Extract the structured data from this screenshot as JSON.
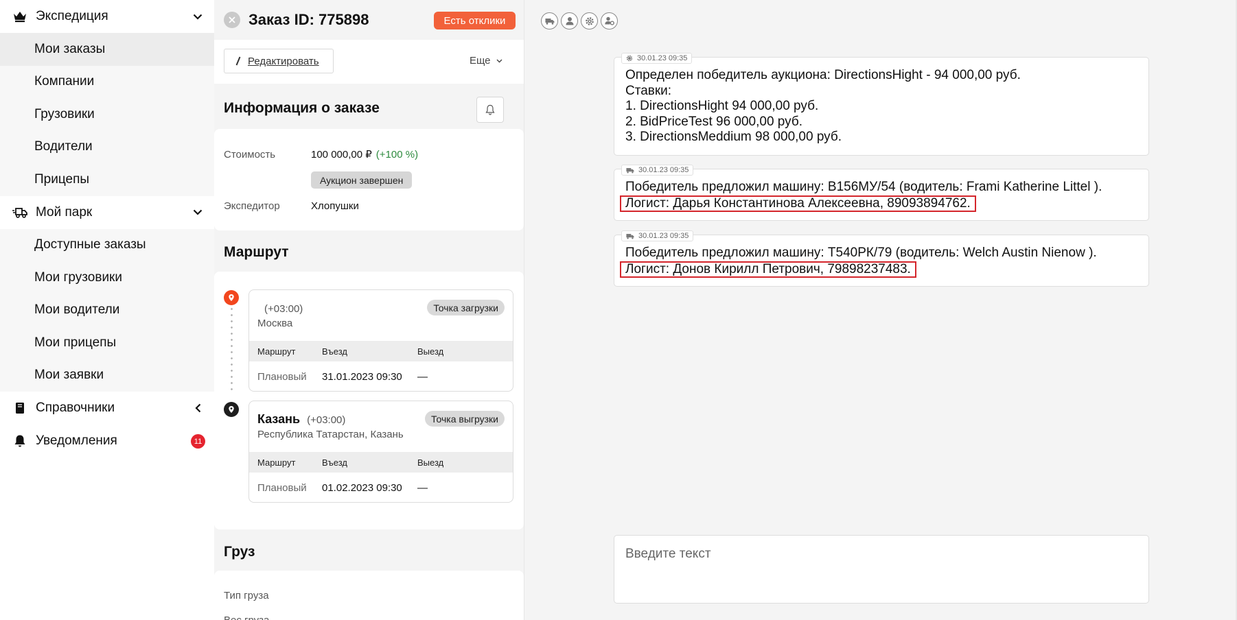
{
  "sidebar": {
    "groups": [
      {
        "label": "Экспедиция",
        "items": [
          "Мои заказы",
          "Компании",
          "Грузовики",
          "Водители",
          "Прицепы"
        ]
      },
      {
        "label": "Мой парк",
        "items": [
          "Доступные заказы",
          "Мои грузовики",
          "Мои водители",
          "Мои прицепы",
          "Мои заявки"
        ]
      },
      {
        "label": "Справочники"
      },
      {
        "label": "Уведомления",
        "badge": "11"
      }
    ],
    "active_item": "Мои заказы",
    "colors": {
      "badge": "#e5242f",
      "active_bg": "#ececec"
    }
  },
  "order": {
    "title": "Заказ ID: 775898",
    "responses_button": "Есть отклики",
    "edit_button": "Редактировать",
    "more_label": "Еще",
    "info": {
      "title": "Информация о заказе",
      "cost_label": "Стоимость",
      "cost_value": "100 000,00 ₽",
      "cost_change": "(+100 %)",
      "status_chip": "Аукцион завершен",
      "forwarder_label": "Экспедитор",
      "forwarder_value": "Хлопушки"
    },
    "route": {
      "title": "Маршрут",
      "table_headers": [
        "Маршрут",
        "Въезд",
        "Выезд"
      ],
      "stops": [
        {
          "city": "",
          "tz": "(+03:00)",
          "address": "Москва",
          "type_chip": "Точка загрузки",
          "row": [
            "Плановый",
            "31.01.2023 09:30",
            "—"
          ]
        },
        {
          "city": "Казань",
          "tz": "(+03:00)",
          "address": "Республика Татарстан, Казань",
          "type_chip": "Точка выгрузки",
          "row": [
            "Плановый",
            "01.02.2023 09:30",
            "—"
          ]
        }
      ]
    },
    "cargo": {
      "title": "Груз",
      "labels": [
        "Тип груза",
        "Вес груза"
      ]
    },
    "colors": {
      "accent": "#f2613a",
      "positive": "#2e8b3f",
      "pin_start": "#f2461e",
      "pin_end": "#1e1e1e"
    }
  },
  "chat": {
    "messages": [
      {
        "icon": "gear-icon",
        "time": "30.01.23 09:35",
        "lines": [
          "Определен победитель аукциона: DirectionsHight - 94 000,00 руб.",
          "Ставки:",
          "1. DirectionsHight 94 000,00 руб.",
          "2. BidPriceTest 96 000,00 руб.",
          "3. DirectionsMeddium 98 000,00 руб."
        ]
      },
      {
        "icon": "truck-icon",
        "time": "30.01.23 09:35",
        "lines": [
          "Победитель предложил машину: В156МУ/54 (водитель:  Frami Katherine Littel )."
        ],
        "highlight": "Логист: Дарья Константинова Алексеевна, 89093894762."
      },
      {
        "icon": "truck-icon",
        "time": "30.01.23 09:35",
        "lines": [
          "Победитель предложил машину: Т540РК/79 (водитель:  Welch Austin Nienow )."
        ],
        "highlight": "Логист: Донов Кирилл Петрович, 79898237483."
      }
    ],
    "input_placeholder": "Введите текст",
    "filter_icons": [
      "truck-icon",
      "user-icon",
      "gear-icon",
      "user-gear-icon"
    ],
    "colors": {
      "highlight_border": "#d4252b"
    }
  }
}
